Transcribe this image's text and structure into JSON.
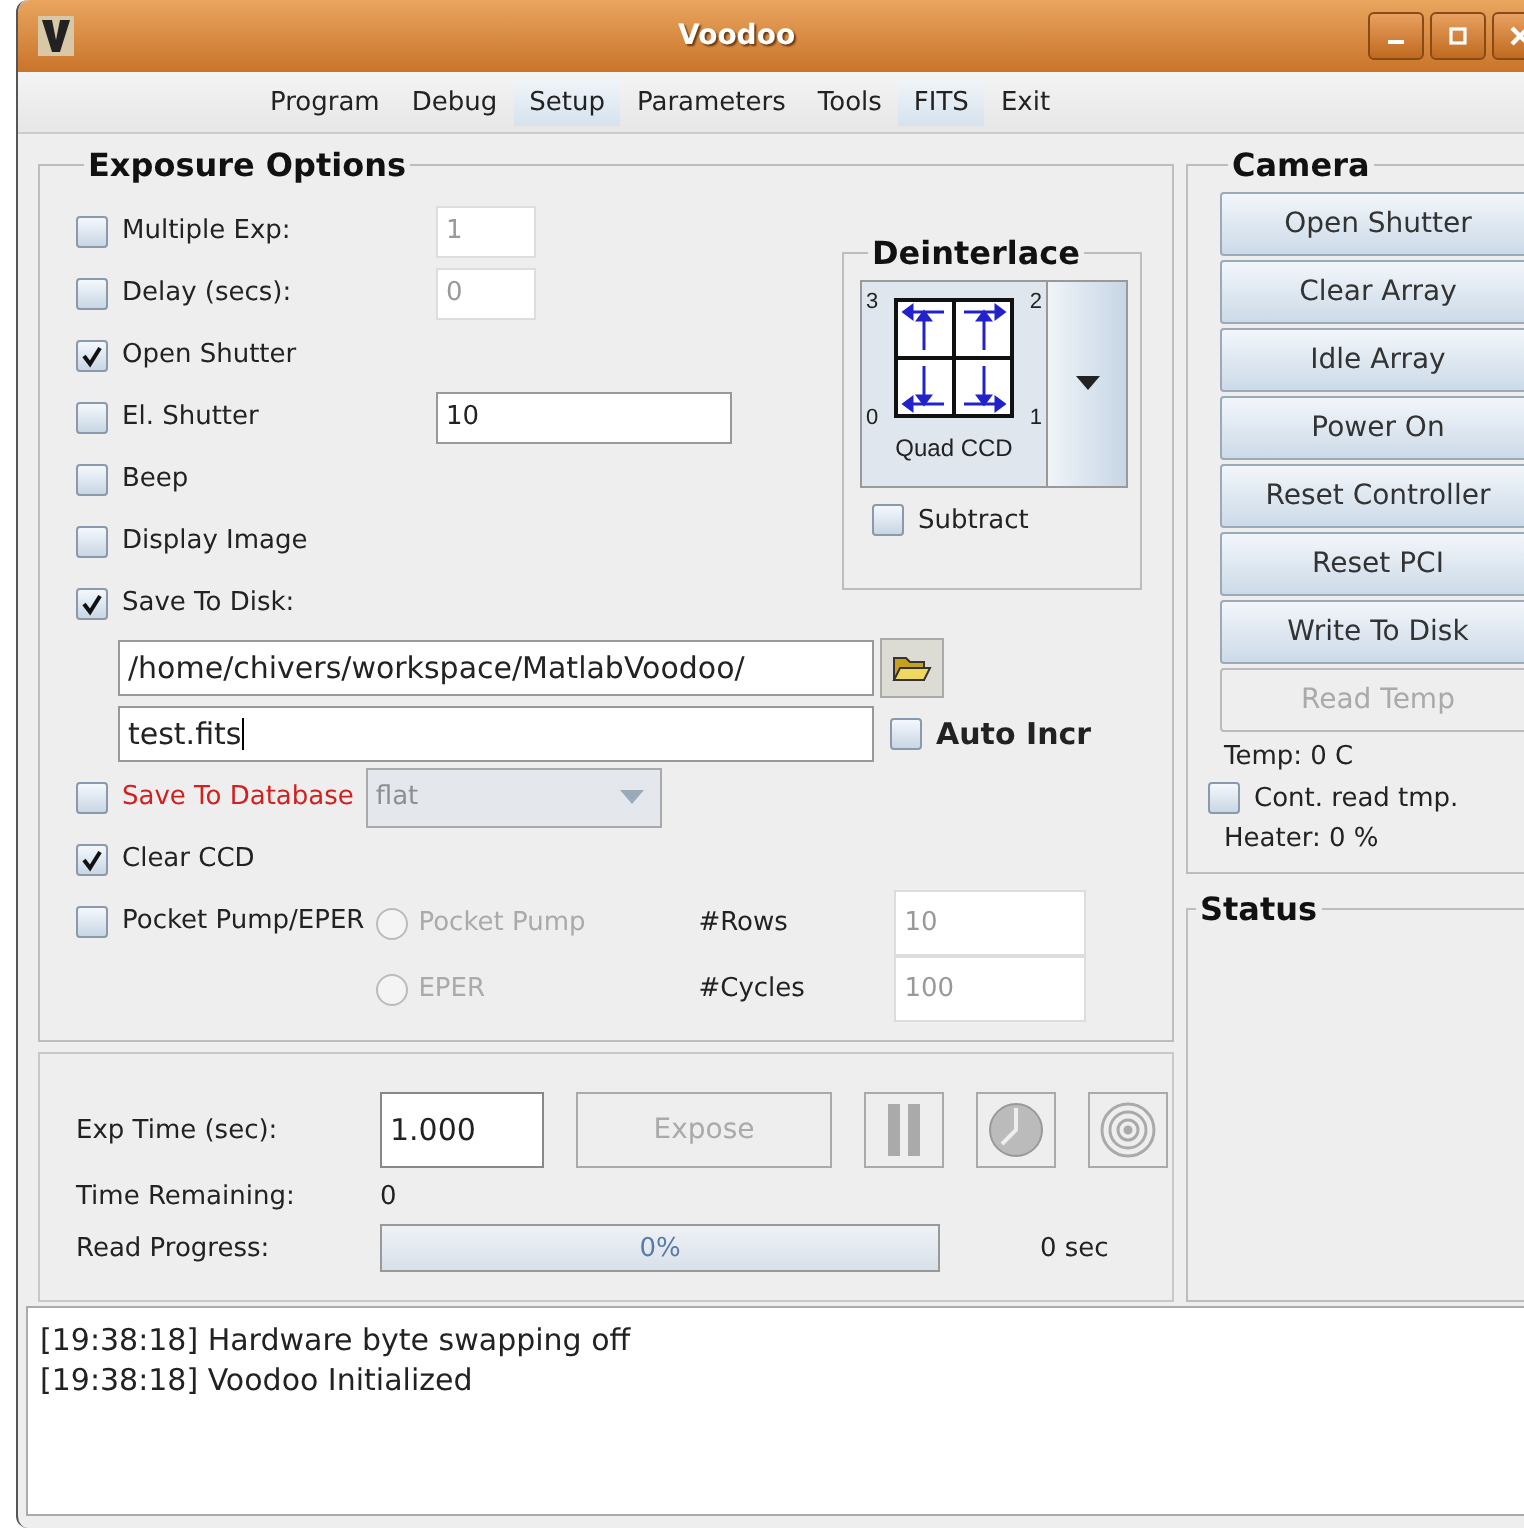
{
  "window": {
    "title": "Voodoo"
  },
  "menu": [
    {
      "label": "Program",
      "highlighted": false
    },
    {
      "label": "Debug",
      "highlighted": false
    },
    {
      "label": "Setup",
      "highlighted": true
    },
    {
      "label": "Parameters",
      "highlighted": false
    },
    {
      "label": "Tools",
      "highlighted": false
    },
    {
      "label": "FITS",
      "highlighted": true
    },
    {
      "label": "Exit",
      "highlighted": false
    }
  ],
  "exposure_options": {
    "title": "Exposure Options",
    "options": [
      {
        "label": "Multiple Exp:",
        "checked": false,
        "field": {
          "value": "1",
          "disabled": true
        }
      },
      {
        "label": "Delay (secs):",
        "checked": false,
        "field": {
          "value": "0",
          "disabled": true
        }
      },
      {
        "label": "Open Shutter",
        "checked": true
      },
      {
        "label": "El. Shutter",
        "checked": false,
        "field": {
          "value": "10",
          "disabled": false
        }
      },
      {
        "label": "Beep",
        "checked": false
      },
      {
        "label": "Display Image",
        "checked": false
      },
      {
        "label": "Save To Disk:",
        "checked": true
      }
    ],
    "path": "/home/chivers/workspace/MatlabVoodoo/",
    "filename": "test.fits",
    "auto_incr": {
      "label": "Auto Incr",
      "checked": false
    },
    "save_to_database": {
      "label": "Save To Database",
      "checked": false,
      "value": "flat",
      "disabled": true
    },
    "clear_ccd": {
      "label": "Clear CCD",
      "checked": true
    },
    "pocket_pump": {
      "label": "Pocket Pump/EPER",
      "checked": false,
      "modes": [
        {
          "label": "Pocket Pump",
          "selected": false,
          "disabled": true
        },
        {
          "label": "EPER",
          "selected": false,
          "disabled": true
        }
      ],
      "fields": [
        {
          "label": "#Rows",
          "value": "10",
          "disabled": true
        },
        {
          "label": "#Cycles",
          "value": "100",
          "disabled": true
        }
      ]
    },
    "deinterlace": {
      "title": "Deinterlace",
      "corners": [
        "3",
        "2",
        "0",
        "1"
      ],
      "mode": "Quad CCD",
      "subtract": {
        "label": "Subtract",
        "checked": false
      }
    }
  },
  "camera": {
    "title": "Camera",
    "buttons": [
      {
        "label": "Open Shutter",
        "disabled": false
      },
      {
        "label": "Clear Array",
        "disabled": false
      },
      {
        "label": "Idle Array",
        "disabled": false
      },
      {
        "label": "Power On",
        "disabled": false
      },
      {
        "label": "Reset Controller",
        "disabled": false
      },
      {
        "label": "Reset PCI",
        "disabled": false
      },
      {
        "label": "Write To Disk",
        "disabled": false
      },
      {
        "label": "Read Temp",
        "disabled": true
      }
    ],
    "temp": "Temp:  0 C",
    "cont_read": {
      "label": "Cont. read tmp.",
      "checked": false
    },
    "heater": "Heater: 0 %"
  },
  "status": {
    "title": "Status"
  },
  "exposure": {
    "exp_time_label": "Exp Time (sec):",
    "exp_time": "1.000",
    "expose": {
      "label": "Expose",
      "disabled": true
    },
    "time_remaining_label": "Time Remaining:",
    "time_remaining": "0",
    "read_progress_label": "Read Progress:",
    "read_progress": {
      "level": 0,
      "text": "0%"
    },
    "elapsed": "0 sec"
  },
  "log": [
    "[19:38:18] Hardware byte swapping off",
    "[19:38:18] Voodoo Initialized"
  ]
}
